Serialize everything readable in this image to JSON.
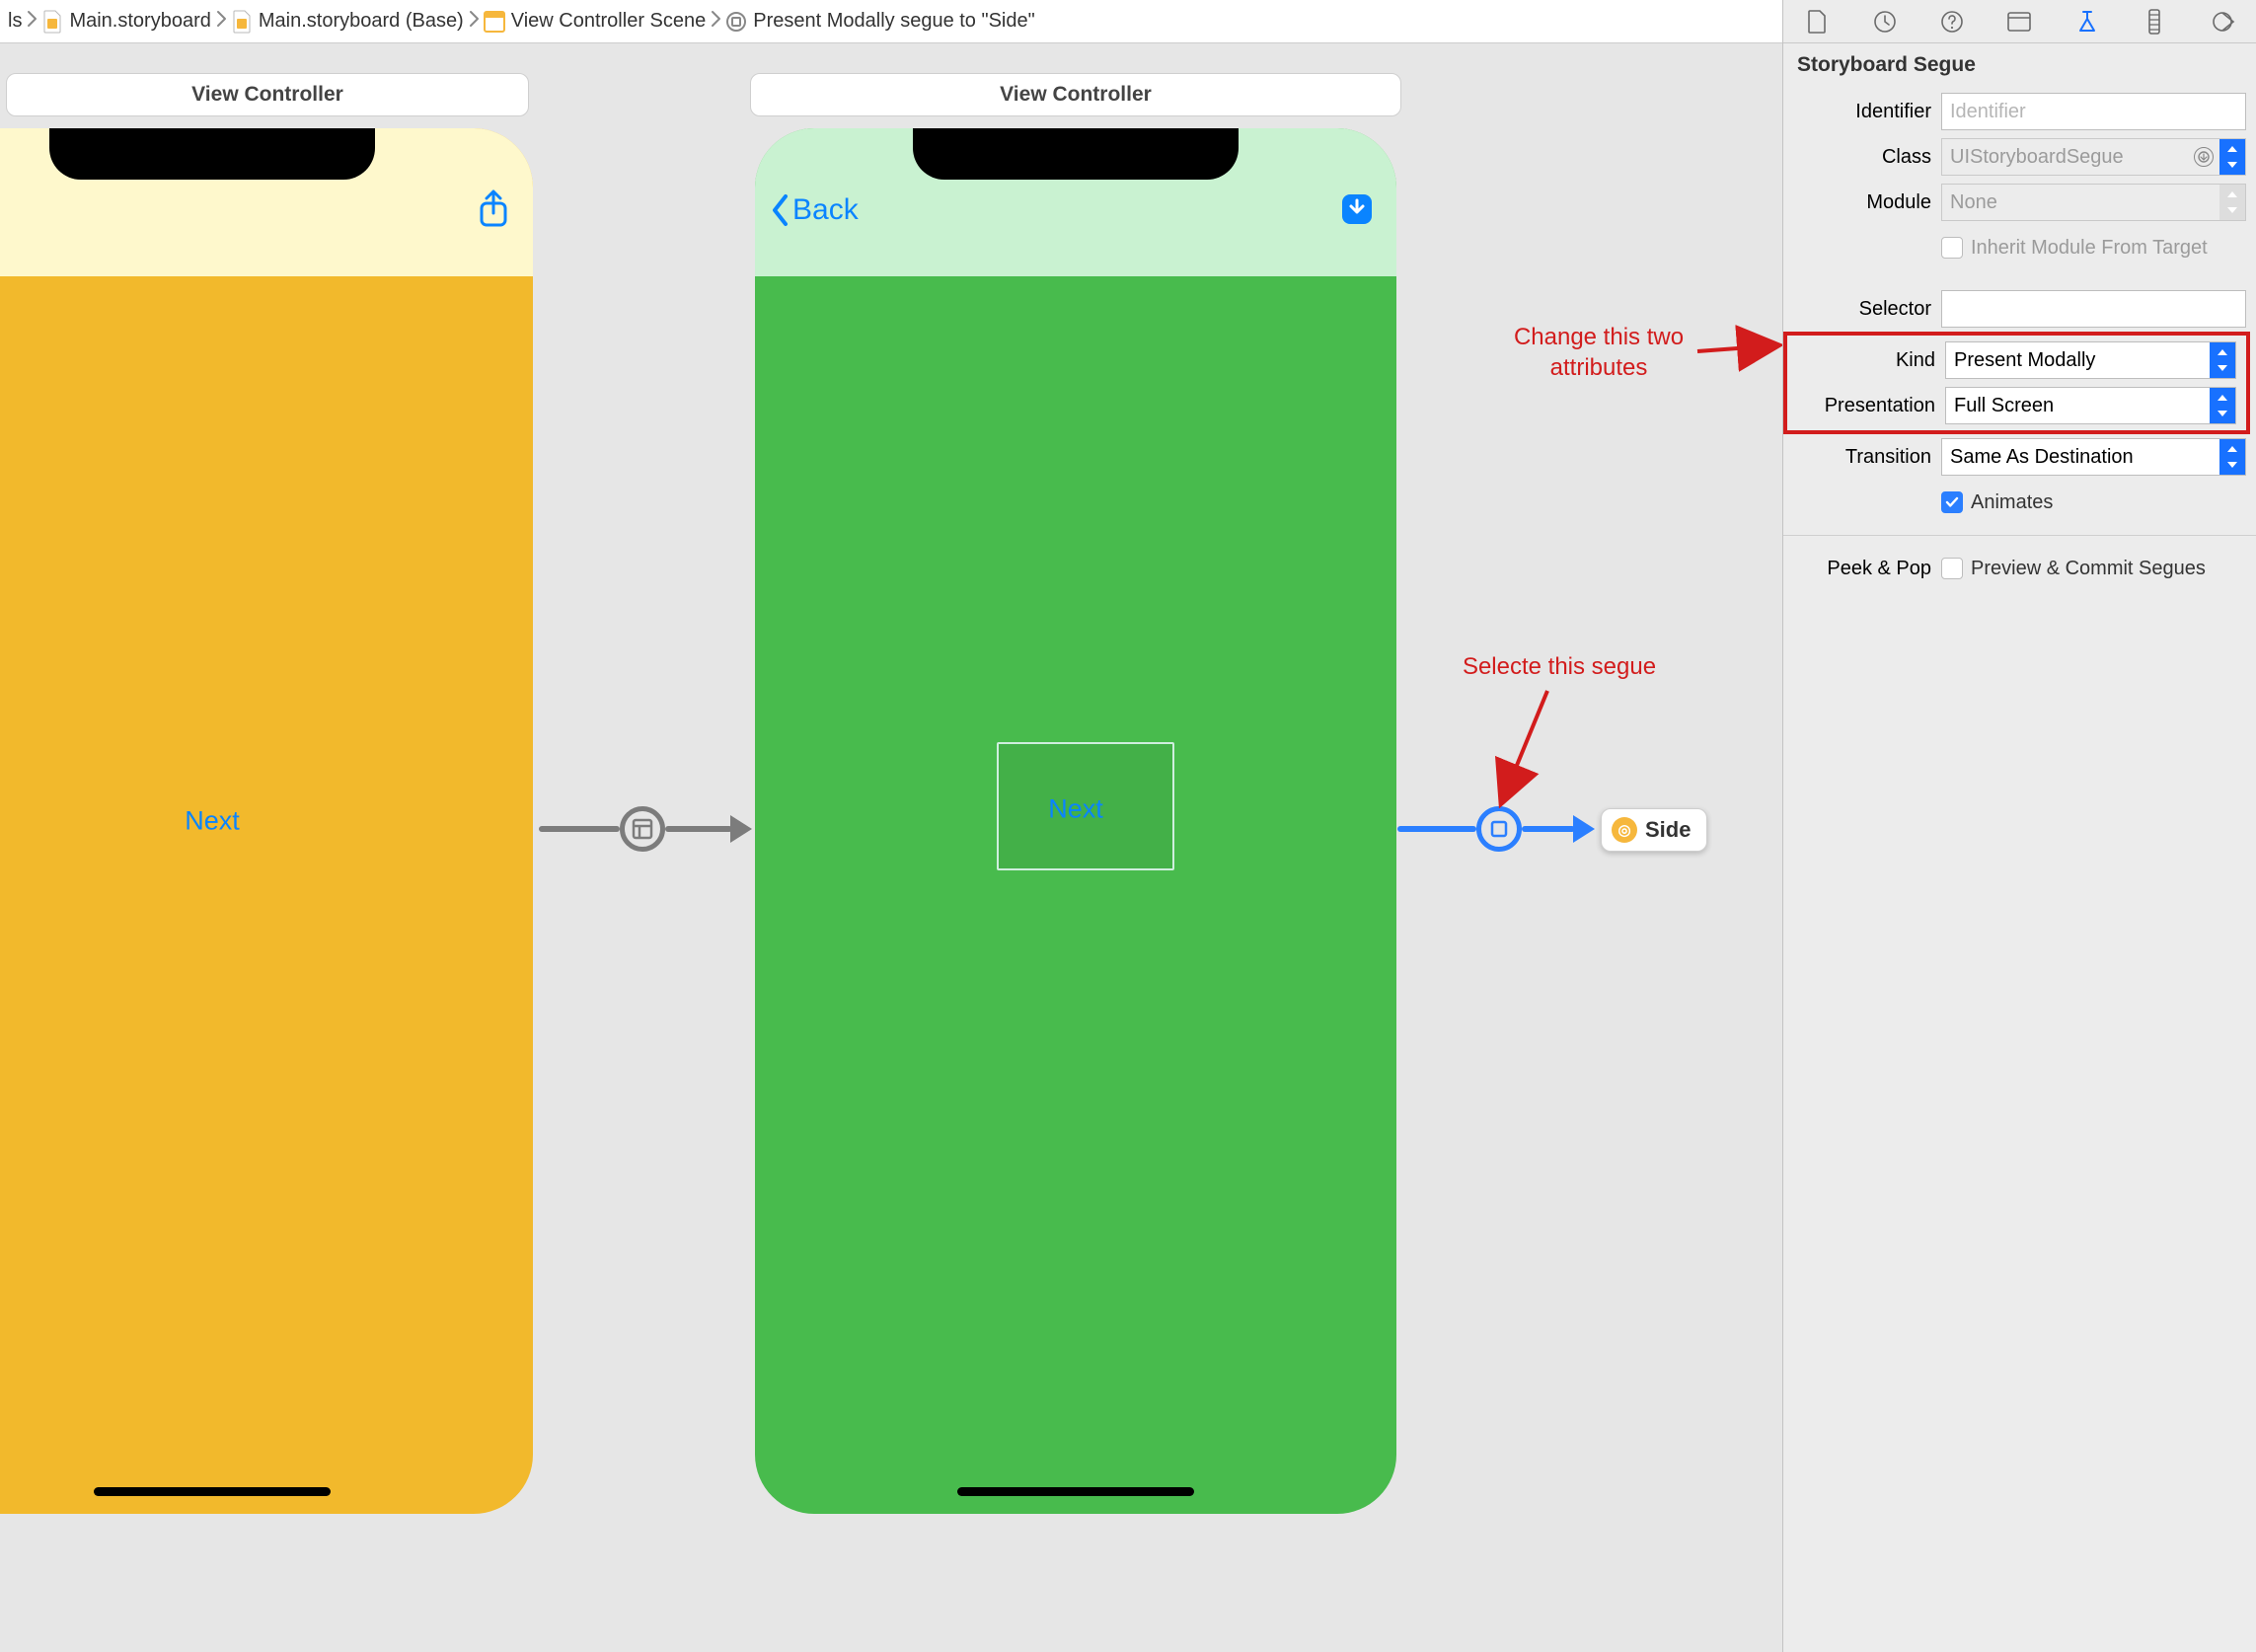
{
  "breadcrumb": {
    "items": [
      {
        "label": "ls"
      },
      {
        "label": "Main.storyboard"
      },
      {
        "label": "Main.storyboard (Base)"
      },
      {
        "label": "View Controller Scene"
      },
      {
        "label": "Present Modally segue to \"Side\""
      }
    ]
  },
  "canvas": {
    "scene1_title": "View Controller",
    "scene2_title": "View Controller",
    "phone1": {
      "center_button": "Next"
    },
    "phone2": {
      "back_label": "Back",
      "center_button": "Next"
    },
    "side_ref_label": "Side"
  },
  "annotations": {
    "change_attrs": "Change this two\nattributes",
    "select_segue": "Selecte this segue"
  },
  "inspector": {
    "section_title": "Storyboard Segue",
    "identifier_label": "Identifier",
    "identifier_placeholder": "Identifier",
    "class_label": "Class",
    "class_value": "UIStoryboardSegue",
    "module_label": "Module",
    "module_value": "None",
    "inherit_label": "Inherit Module From Target",
    "selector_label": "Selector",
    "selector_value": "",
    "kind_label": "Kind",
    "kind_value": "Present Modally",
    "presentation_label": "Presentation",
    "presentation_value": "Full Screen",
    "transition_label": "Transition",
    "transition_value": "Same As Destination",
    "animates_label": "Animates",
    "animates_checked": true,
    "peekpop_label": "Peek & Pop",
    "peekpop_text": "Preview & Commit Segues",
    "peekpop_checked": false
  }
}
